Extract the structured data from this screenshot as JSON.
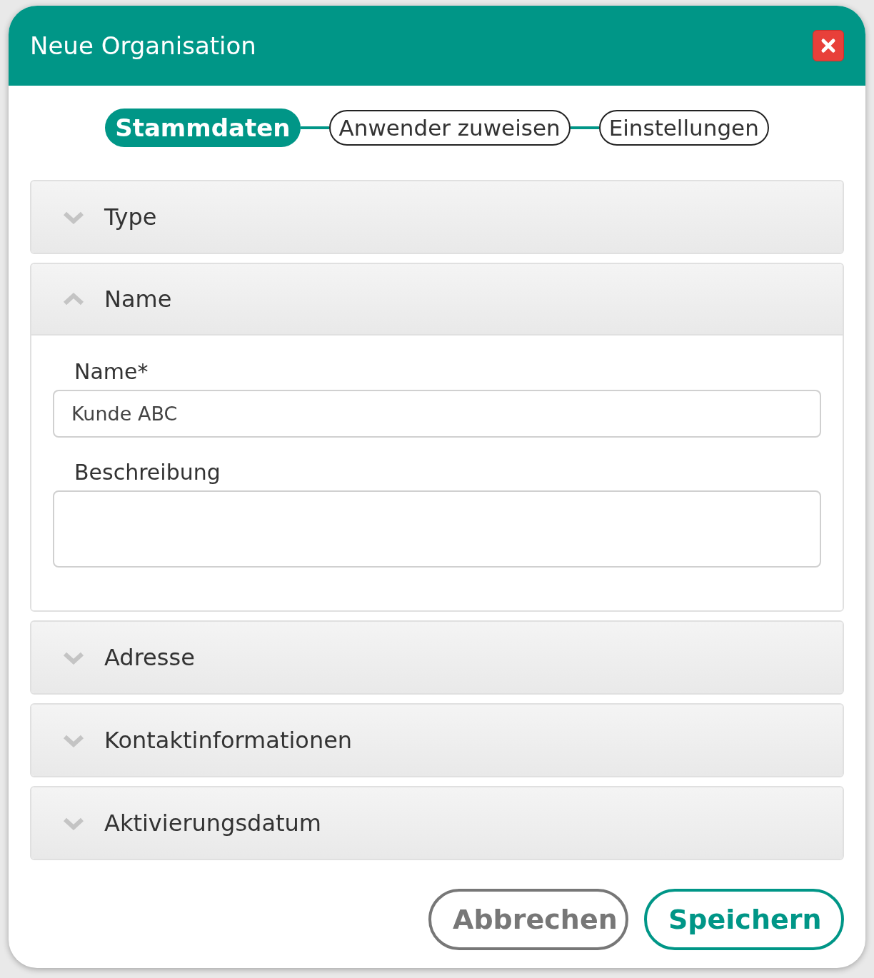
{
  "dialog": {
    "title": "Neue Organisation"
  },
  "steps": [
    {
      "label": "Stammdaten",
      "selected": true
    },
    {
      "label": "Anwender zuweisen",
      "selected": false
    },
    {
      "label": "Einstellungen",
      "selected": false
    }
  ],
  "sections": [
    {
      "title": "Type",
      "expanded": false
    },
    {
      "title": "Name",
      "expanded": true,
      "fields": [
        {
          "label": "Name*",
          "kind": "input",
          "value": "Kunde ABC"
        },
        {
          "label": "Beschreibung",
          "kind": "textarea"
        }
      ]
    },
    {
      "title": "Adresse",
      "expanded": false
    },
    {
      "title": "Kontaktinformationen",
      "expanded": false
    },
    {
      "title": "Aktivierungsdatum",
      "expanded": false
    }
  ],
  "buttons": [
    {
      "label": "Abbrechen",
      "kind": "cancel"
    },
    {
      "label": "Speichern",
      "kind": "primary"
    }
  ]
}
